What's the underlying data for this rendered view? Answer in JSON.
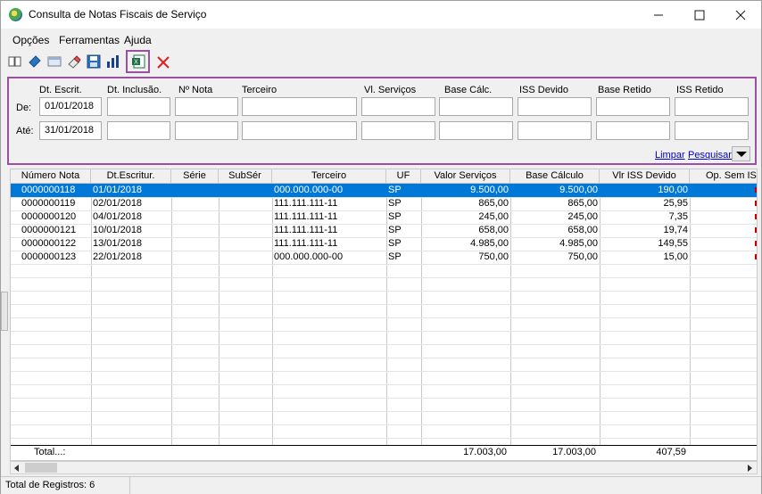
{
  "window": {
    "title": "Consulta de Notas Fiscais de Serviço"
  },
  "menu": [
    "Opções",
    "Ferramentas",
    "Ajuda"
  ],
  "toolbar": {
    "icons": [
      "book-icon",
      "bookmark-icon",
      "window-icon",
      "eraser-icon",
      "save-icon",
      "chart-icon",
      "excel-export-icon",
      "close-icon"
    ]
  },
  "filters": {
    "columns": [
      "Dt. Escrit.",
      "Dt. Inclusão.",
      "Nº Nota",
      "Terceiro",
      "Vl. Serviços",
      "Base Cálc.",
      "ISS Devido",
      "Base Retido",
      "ISS Retido"
    ],
    "from_label": "De:",
    "to_label": "Até:",
    "from_date": "01/01/2018",
    "to_date": "31/01/2018",
    "clear_label": "Limpar",
    "search_label": "Pesquisar"
  },
  "table": {
    "headers": [
      "Número Nota",
      "Dt.Escritur.",
      "Série",
      "SubSér",
      "Terceiro",
      "UF",
      "Valor Serviços",
      "Base Cálculo",
      "Vlr ISS Devido",
      "Op. Sem ISS"
    ],
    "rows": [
      [
        "0000000118",
        "01/01/2018",
        "",
        "",
        "000.000.000-00",
        "SP",
        "9.500,00",
        "9.500,00",
        "190,00"
      ],
      [
        "0000000119",
        "02/01/2018",
        "",
        "",
        "111.111.111-11",
        "SP",
        "865,00",
        "865,00",
        "25,95"
      ],
      [
        "0000000120",
        "04/01/2018",
        "",
        "",
        "111.111.111-11",
        "SP",
        "245,00",
        "245,00",
        "7,35"
      ],
      [
        "0000000121",
        "10/01/2018",
        "",
        "",
        "111.111.111-11",
        "SP",
        "658,00",
        "658,00",
        "19,74"
      ],
      [
        "0000000122",
        "13/01/2018",
        "",
        "",
        "111.111.111-11",
        "SP",
        "4.985,00",
        "4.985,00",
        "149,55"
      ],
      [
        "0000000123",
        "22/01/2018",
        "",
        "",
        "000.000.000-00",
        "SP",
        "750,00",
        "750,00",
        "15,00"
      ]
    ],
    "total_label": "Total...:",
    "total_valor": "17.003,00",
    "total_base": "17.003,00",
    "total_iss": "407,59"
  },
  "status": {
    "text": "Total de Registros: 6"
  },
  "colors": {
    "selection": "#0078d7",
    "highlight_border": "#9b4fa0",
    "link": "#0000cc"
  }
}
